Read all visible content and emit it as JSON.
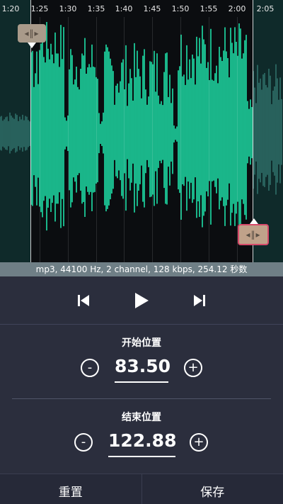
{
  "timeline": {
    "ticks": [
      "1:20",
      "1:25",
      "1:30",
      "1:35",
      "1:40",
      "1:45",
      "1:50",
      "1:55",
      "2:00",
      "2:05"
    ]
  },
  "info": {
    "text": "mp3, 44100 Hz, 2 channel, 128 kbps, 254.12 秒数"
  },
  "transport": {
    "prev_icon": "skip-previous-icon",
    "play_icon": "play-icon",
    "next_icon": "skip-next-icon"
  },
  "start": {
    "label": "开始位置",
    "value": "83.50",
    "minus": "-",
    "plus": "+"
  },
  "end": {
    "label": "结束位置",
    "value": "122.88",
    "minus": "-",
    "plus": "+"
  },
  "actions": {
    "reset": "重置",
    "save": "保存"
  },
  "colors": {
    "waveform": "#1fe0a8",
    "background": "#2b2e3d",
    "info_bar": "#6f7f86"
  }
}
